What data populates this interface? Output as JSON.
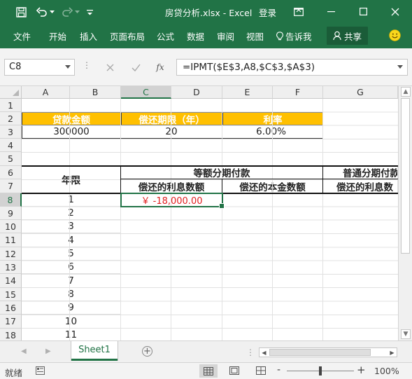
{
  "window": {
    "title": "房贷分析.xlsx  -  Excel",
    "login": "登录"
  },
  "ribbon": {
    "tabs": [
      "文件",
      "开始",
      "插入",
      "页面布局",
      "公式",
      "数据",
      "审阅",
      "视图"
    ],
    "tell_me": "告诉我",
    "share": "共享"
  },
  "formula_bar": {
    "name_box": "C8",
    "fx": "fx",
    "formula": "=IPMT($E$3,A8,$C$3,$A$3)"
  },
  "columns": [
    "A",
    "B",
    "C",
    "D",
    "E",
    "F",
    "G"
  ],
  "rows": [
    "1",
    "2",
    "3",
    "4",
    "5",
    "6",
    "7",
    "8",
    "9",
    "10",
    "11",
    "12",
    "13",
    "14",
    "15",
    "16",
    "17",
    "18"
  ],
  "sheet": {
    "loan_amount_label": "贷款金额",
    "loan_term_label": "偿还期限（年）",
    "rate_label": "利率",
    "loan_amount": "300000",
    "loan_term": "20",
    "rate": "6.00%",
    "year_label": "年限",
    "equal_installment": "等额分期付款",
    "normal_installment": "普通分期付款",
    "interest_paid": "偿还的利息数额",
    "principal_paid": "偿还的本金数额",
    "interest_paid_g": "偿还的利息数",
    "years": [
      "1",
      "2",
      "3",
      "4",
      "5",
      "6",
      "7",
      "8",
      "9",
      "10",
      "11"
    ],
    "c8_value": "￥ -18,000.00"
  },
  "tabs_bar": {
    "sheet_name": "Sheet1",
    "add": "+"
  },
  "status_bar": {
    "ready": "就绪",
    "zoom_minus": "-",
    "zoom_plus": "+",
    "zoom": "100%"
  },
  "colors": {
    "excel_green": "#217346",
    "header_orange": "#ffc000",
    "negative_red": "#e02020"
  }
}
